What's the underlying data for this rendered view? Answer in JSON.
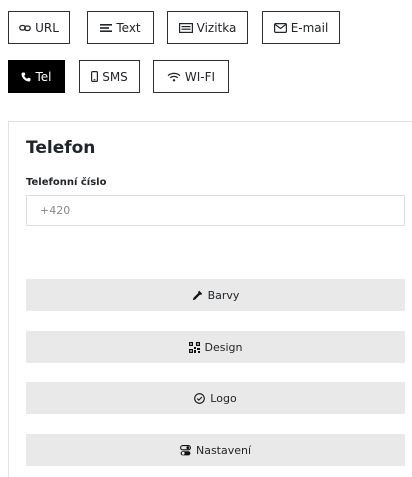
{
  "type_tabs": [
    {
      "label": "URL",
      "icon": "link-icon"
    },
    {
      "label": "Text",
      "icon": "text-lines-icon"
    },
    {
      "label": "Vizitka",
      "icon": "id-card-icon"
    },
    {
      "label": "E-mail",
      "icon": "envelope-icon"
    },
    {
      "label": "Tel",
      "icon": "phone-icon",
      "active": true
    },
    {
      "label": "SMS",
      "icon": "mobile-icon"
    },
    {
      "label": "WI-FI",
      "icon": "wifi-icon"
    }
  ],
  "form": {
    "title": "Telefon",
    "phone_label": "Telefonní číslo",
    "phone_placeholder": "+420",
    "phone_value": ""
  },
  "sections": [
    {
      "label": "Barvy",
      "icon": "eyedropper-icon"
    },
    {
      "label": "Design",
      "icon": "qr-code-icon"
    },
    {
      "label": "Logo",
      "icon": "check-circle-icon"
    },
    {
      "label": "Nastavení",
      "icon": "toggles-icon"
    }
  ],
  "colors": {
    "active_tab_bg": "#000000",
    "section_bg": "#e9e9e9",
    "border": "#2f2f2f"
  }
}
